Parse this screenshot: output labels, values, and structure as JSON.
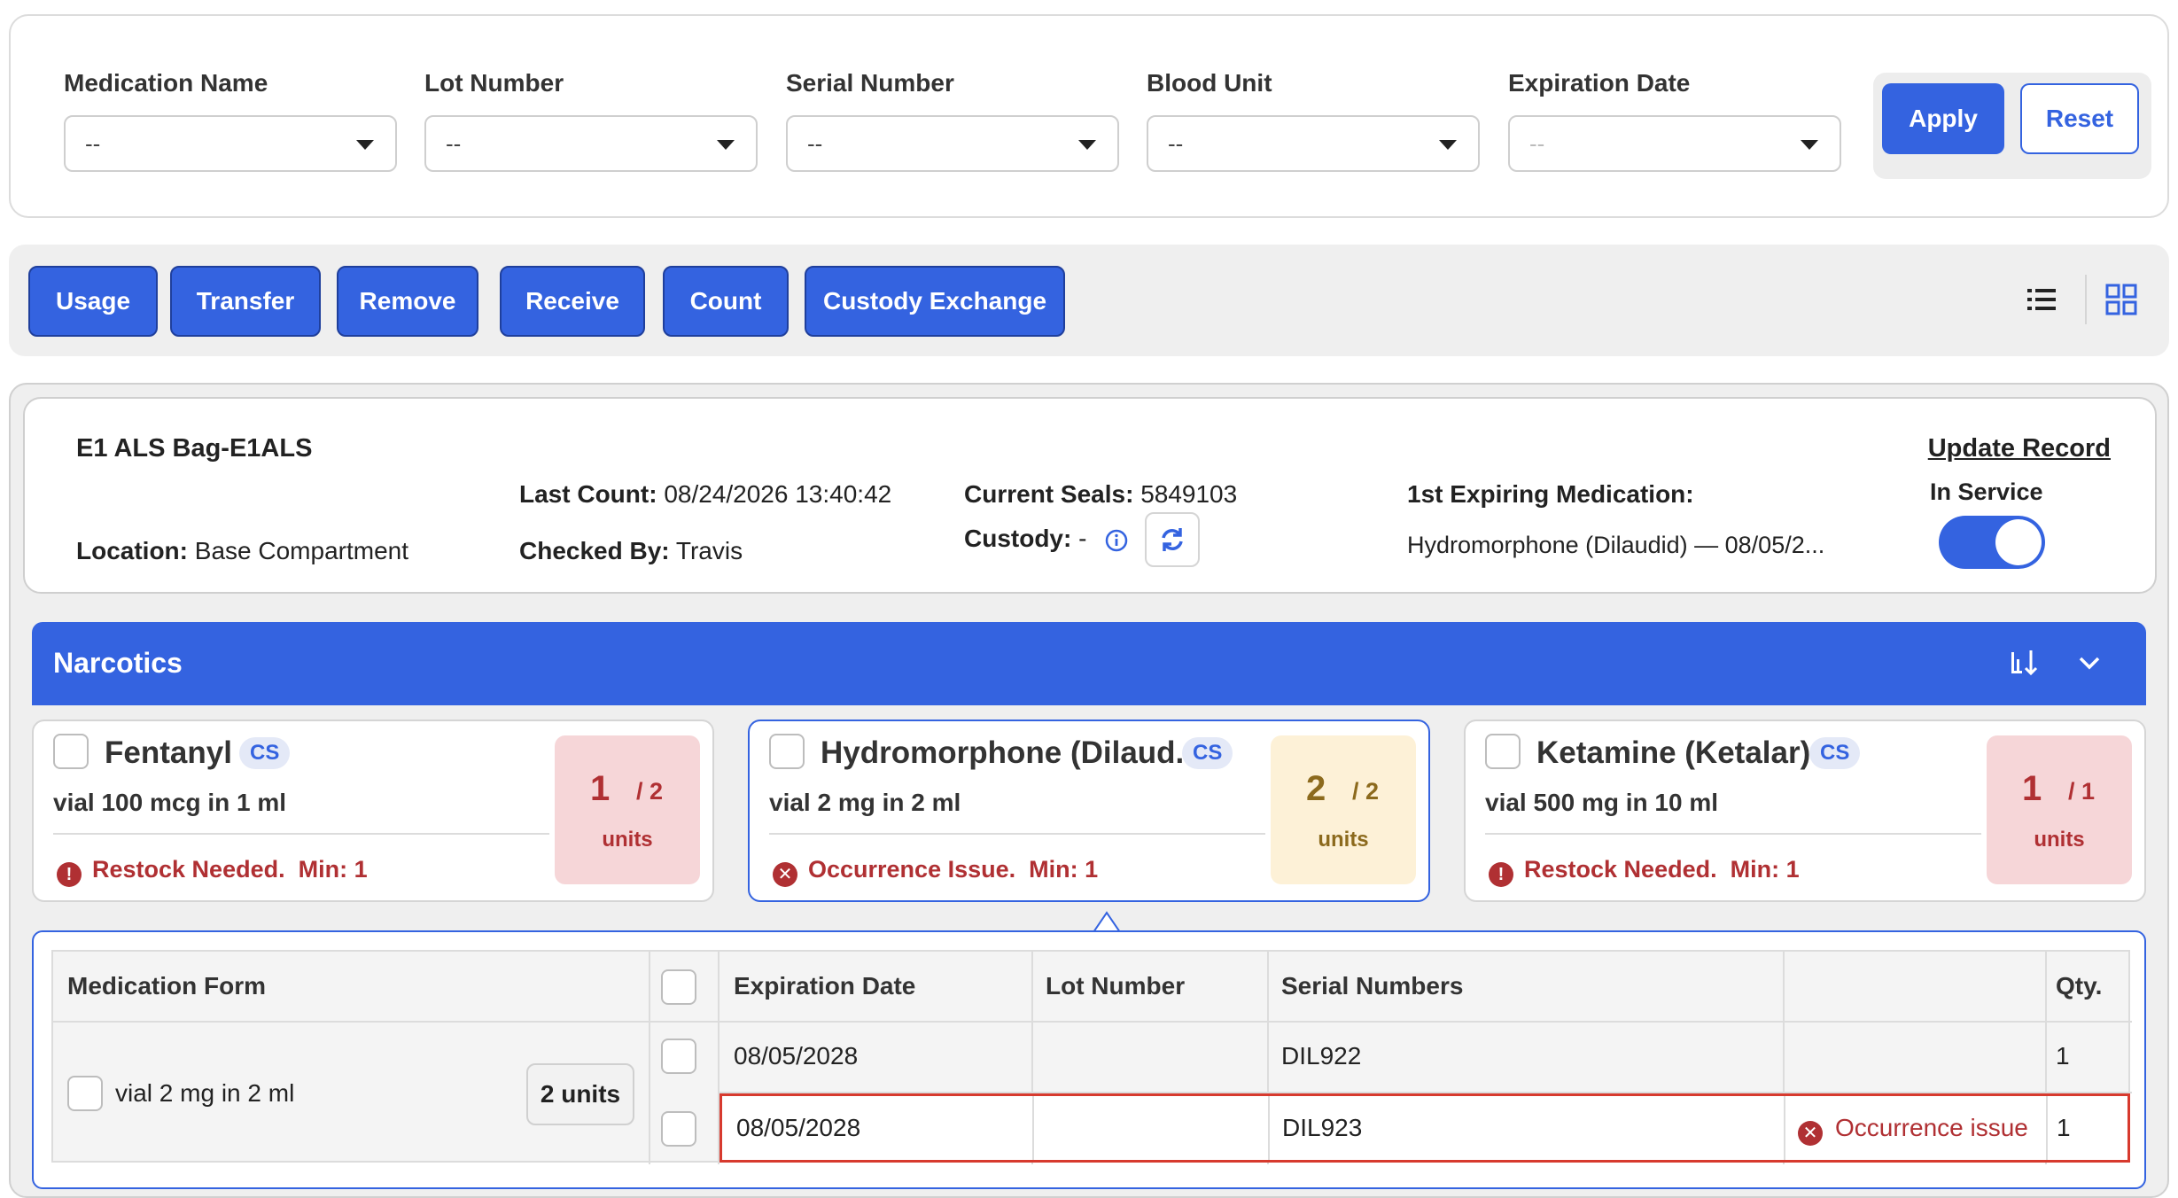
{
  "filters": [
    {
      "label": "Medication Name",
      "value": "--"
    },
    {
      "label": "Lot Number",
      "value": "--"
    },
    {
      "label": "Serial Number",
      "value": "--"
    },
    {
      "label": "Blood Unit",
      "value": "--"
    },
    {
      "label": "Expiration Date",
      "value": "--"
    }
  ],
  "filter_buttons": {
    "apply": "Apply",
    "reset": "Reset"
  },
  "actions": [
    "Usage",
    "Transfer",
    "Remove",
    "Receive",
    "Count",
    "Custody Exchange"
  ],
  "view_icons": [
    "list-view-icon",
    "grid-view-icon"
  ],
  "colors": {
    "accent": "#3463e0",
    "danger": "#b03033",
    "warning_bg": "#fdf1d7",
    "danger_bg": "#f6d6d8"
  },
  "record": {
    "title": "E1 ALS Bag-E1ALS",
    "update_link": "Update Record",
    "location_label": "Location:",
    "location_value": "Base Compartment",
    "last_count_label": "Last Count:",
    "last_count_value": "08/24/2026 13:40:42",
    "checked_by_label": "Checked By:",
    "checked_by_value": "Travis",
    "current_seals_label": "Current Seals:",
    "current_seals_value": "5849103",
    "custody_label": "Custody:",
    "custody_value": "-",
    "first_expiring_label": "1st Expiring Medication:",
    "first_expiring_value": "Hydromorphone (Dilaudid) — 08/05/2...",
    "in_service_label": "In Service",
    "in_service": true
  },
  "section": {
    "title": "Narcotics"
  },
  "medications": [
    {
      "name": "Fentanyl",
      "badge": "CS",
      "desc": "vial 100 mcg in 1 ml",
      "status": "Restock Needed.",
      "min": "Min: 1",
      "count": "1",
      "of": "/ 2",
      "units": "units",
      "status_icon": "alert-icon"
    },
    {
      "name": "Hydromorphone (Dilaud...",
      "badge": "CS",
      "desc": "vial 2 mg in 2 ml",
      "status": "Occurrence Issue.",
      "min": "Min: 1",
      "count": "2",
      "of": "/ 2",
      "units": "units",
      "status_icon": "error-x-icon"
    },
    {
      "name": "Ketamine (Ketalar)",
      "badge": "CS",
      "desc": "vial 500 mg in 10 ml",
      "status": "Restock Needed.",
      "min": "Min: 1",
      "count": "1",
      "of": "/ 1",
      "units": "units",
      "status_icon": "alert-icon"
    }
  ],
  "detail_table": {
    "headers": {
      "form": "Medication Form",
      "expiration": "Expiration Date",
      "lot": "Lot Number",
      "serials": "Serial Numbers",
      "issue": "",
      "qty": "Qty."
    },
    "form_row": {
      "label": "vial 2 mg in 2 ml",
      "units": "2 units"
    },
    "rows": [
      {
        "expiration": "08/05/2028",
        "lot": "",
        "serial": "DIL922",
        "issue": "",
        "qty": "1"
      },
      {
        "expiration": "08/05/2028",
        "lot": "",
        "serial": "DIL923",
        "issue": "Occurrence issue",
        "qty": "1"
      }
    ]
  }
}
